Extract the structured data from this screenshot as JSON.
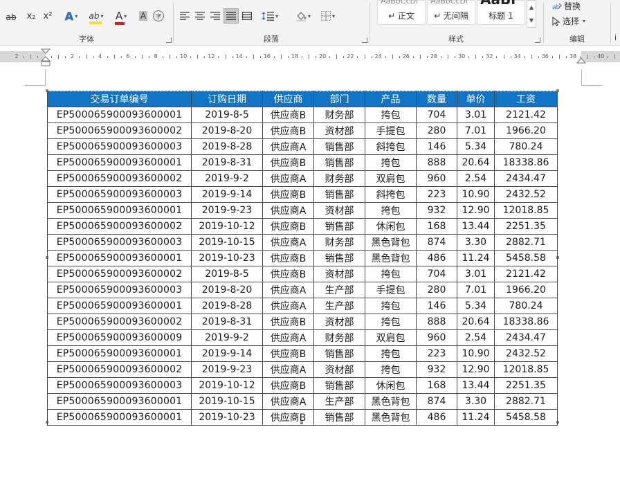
{
  "ribbon": {
    "font_group_label": "字体",
    "paragraph_group_label": "段落",
    "styles_group_label": "样式",
    "editing_group_label": "编辑",
    "styles": [
      {
        "preview": "AaBbCcDi",
        "name": "↵ 正文"
      },
      {
        "preview": "AaBbCcDi",
        "name": "↵ 无间隔"
      },
      {
        "preview": "AaBl",
        "name": "标题 1"
      }
    ],
    "replace_label": "替换",
    "select_label": "选择",
    "font_buttons": {
      "subscript": "x₂",
      "superscript": "x²",
      "text_effect": "A",
      "highlight": "ab",
      "font_color": "A",
      "char_shading": "A",
      "enclose": "字"
    }
  },
  "ruler": {
    "ticks": [
      "2",
      "",
      "2",
      "4",
      "6",
      "8",
      "10",
      "12",
      "14",
      "16",
      "18",
      "20",
      "22",
      "24",
      "26",
      "28",
      "30",
      "32",
      "34",
      "36",
      "38",
      "40"
    ]
  },
  "table": {
    "headers": [
      "交易订单编号",
      "订购日期",
      "供应商",
      "部门",
      "产品",
      "数量",
      "单价",
      "工资"
    ],
    "rows": [
      [
        "EP500065900093600001",
        "2019-8-5",
        "供应商B",
        "财务部",
        "挎包",
        "704",
        "3.01",
        "2121.42"
      ],
      [
        "EP500065900093600002",
        "2019-8-20",
        "供应商B",
        "资材部",
        "手提包",
        "280",
        "7.01",
        "1966.20"
      ],
      [
        "EP500065900093600003",
        "2019-8-28",
        "供应商A",
        "销售部",
        "斜挎包",
        "146",
        "5.34",
        "780.24"
      ],
      [
        "EP500065900093600001",
        "2019-8-31",
        "供应商B",
        "销售部",
        "挎包",
        "888",
        "20.64",
        "18338.86"
      ],
      [
        "EP500065900093600002",
        "2019-9-2",
        "供应商A",
        "财务部",
        "双肩包",
        "960",
        "2.54",
        "2434.47"
      ],
      [
        "EP500065900093600003",
        "2019-9-14",
        "供应商B",
        "销售部",
        "斜挎包",
        "223",
        "10.90",
        "2432.52"
      ],
      [
        "EP500065900093600001",
        "2019-9-23",
        "供应商A",
        "资材部",
        "挎包",
        "932",
        "12.90",
        "12018.85"
      ],
      [
        "EP500065900093600002",
        "2019-10-12",
        "供应商B",
        "销售部",
        "休闲包",
        "168",
        "13.44",
        "2251.35"
      ],
      [
        "EP500065900093600003",
        "2019-10-15",
        "供应商A",
        "财务部",
        "黑色背包",
        "874",
        "3.30",
        "2882.71"
      ],
      [
        "EP500065900093600001",
        "2019-10-23",
        "供应商B",
        "销售部",
        "黑色背包",
        "486",
        "11.24",
        "5458.58"
      ],
      [
        "EP500065900093600002",
        "2019-8-5",
        "供应商B",
        "资材部",
        "挎包",
        "704",
        "3.01",
        "2121.42"
      ],
      [
        "EP500065900093600003",
        "2019-8-20",
        "供应商A",
        "生产部",
        "手提包",
        "280",
        "7.01",
        "1966.20"
      ],
      [
        "EP500065900093600001",
        "2019-8-28",
        "供应商A",
        "生产部",
        "挎包",
        "146",
        "5.34",
        "780.24"
      ],
      [
        "EP500065900093600002",
        "2019-8-31",
        "供应商B",
        "资材部",
        "挎包",
        "888",
        "20.64",
        "18338.86"
      ],
      [
        "EP500065900093600009",
        "2019-9-2",
        "供应商A",
        "财务部",
        "双肩包",
        "960",
        "2.54",
        "2434.47"
      ],
      [
        "EP500065900093600001",
        "2019-9-14",
        "供应商B",
        "销售部",
        "挎包",
        "223",
        "10.90",
        "2432.52"
      ],
      [
        "EP500065900093600002",
        "2019-9-23",
        "供应商A",
        "资材部",
        "挎包",
        "932",
        "12.90",
        "12018.85"
      ],
      [
        "EP500065900093600003",
        "2019-10-12",
        "供应商B",
        "销售部",
        "休闲包",
        "168",
        "13.44",
        "2251.35"
      ],
      [
        "EP500065900093600001",
        "2019-10-15",
        "供应商A",
        "生产部",
        "黑色背包",
        "874",
        "3.30",
        "2882.71"
      ],
      [
        "EP500065900093600001",
        "2019-10-23",
        "供应商B",
        "销售部",
        "黑色背包",
        "486",
        "11.24",
        "5458.58"
      ]
    ]
  },
  "colors": {
    "header_bg": "#1274c4",
    "header_text": "#ffffff",
    "highlight_yellow": "#f5e02a",
    "font_red": "#d21f1f"
  }
}
